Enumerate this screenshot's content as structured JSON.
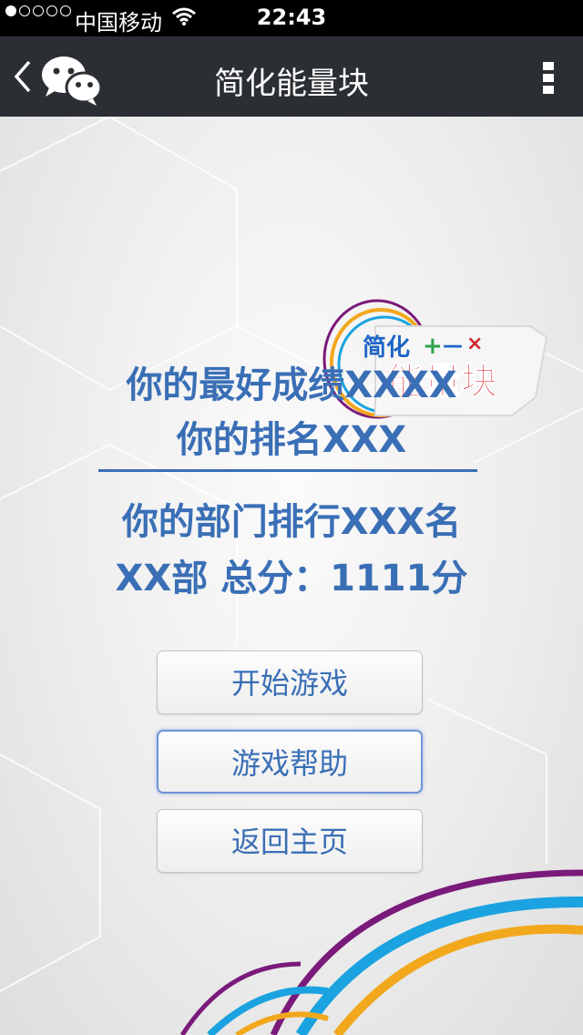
{
  "status_bar": {
    "carrier": "中国移动",
    "time": "22:43",
    "signal_bars_filled": 1,
    "signal_bars_total": 5
  },
  "nav_bar": {
    "title": "简化能量块",
    "back_icon": "chevron-left-icon",
    "app_icon": "wechat-icon",
    "menu_icon": "more-vertical-icon"
  },
  "game_logo": {
    "small_text": "简化",
    "big_text": "能量块",
    "symbols": [
      "+",
      "—",
      "×"
    ]
  },
  "score": {
    "best": "你的最好成绩XXXX",
    "rank": "你的排名XXX",
    "dept_rank": "你的部门排行XXX名",
    "dept_total": "XX部  总分：1111分"
  },
  "buttons": {
    "start": "开始游戏",
    "help": "游戏帮助",
    "home": "返回主页"
  },
  "colors": {
    "accent": "#3a6fb6",
    "navbar": "#2b2f33",
    "arc_purple": "#7a1a7a",
    "arc_orange": "#f2a81d",
    "arc_cyan": "#1aa3e0"
  }
}
